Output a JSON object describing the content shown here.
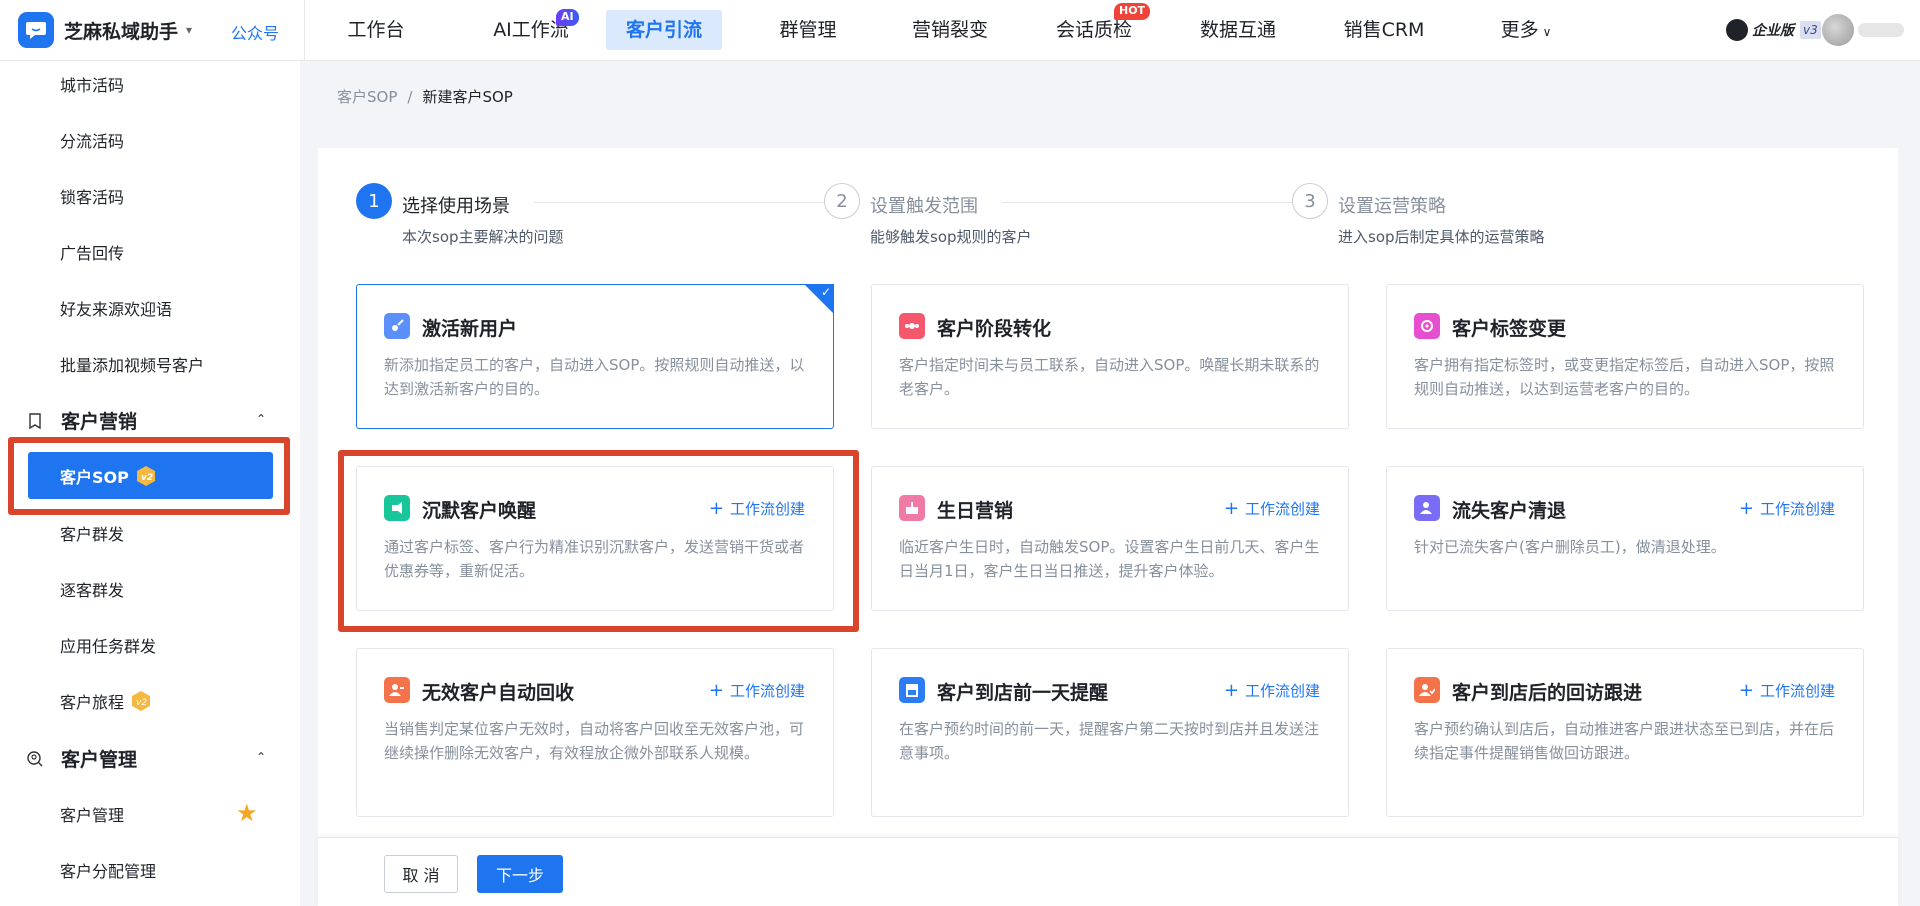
{
  "brand": {
    "name": "芝麻私域助手",
    "sub": "公众号"
  },
  "nav": [
    {
      "label": "工作台"
    },
    {
      "label": "AI工作流",
      "badge": "AI"
    },
    {
      "label": "客户引流",
      "active": true
    },
    {
      "label": "群管理"
    },
    {
      "label": "营销裂变"
    },
    {
      "label": "会话质检",
      "badge": "HOT"
    },
    {
      "label": "数据互通"
    },
    {
      "label": "销售CRM"
    },
    {
      "label": "更多"
    }
  ],
  "account": {
    "edition": "企业版",
    "version": "v3"
  },
  "sidebar": {
    "items_top": [
      "城市活码",
      "分流活码",
      "锁客活码",
      "广告回传",
      "好友来源欢迎语",
      "批量添加视频号客户"
    ],
    "group_marketing": "客户营销",
    "active_item": "客户SOP",
    "items_marketing": [
      "客户群发",
      "逐客群发",
      "应用任务群发",
      "客户旅程"
    ],
    "group_manage": "客户管理",
    "items_manage": [
      "客户管理",
      "客户分配管理"
    ]
  },
  "breadcrumb": {
    "parent": "客户SOP",
    "separator": "/",
    "current": "新建客户SOP"
  },
  "steps": [
    {
      "num": "1",
      "title": "选择使用场景",
      "desc": "本次sop主要解决的问题"
    },
    {
      "num": "2",
      "title": "设置触发范围",
      "desc": "能够触发sop规则的客户"
    },
    {
      "num": "3",
      "title": "设置运营策略",
      "desc": "进入sop后制定具体的运营策略"
    }
  ],
  "workflow_label": "工作流创建",
  "cards": [
    {
      "title": "激活新用户",
      "desc": "新添加指定员工的客户，自动进入SOP。按照规则自动推送，以达到激活新客户的目的。",
      "icon_color": "#5b8ff9"
    },
    {
      "title": "客户阶段转化",
      "desc": "客户指定时间未与员工联系，自动进入SOP。唤醒长期未联系的老客户。",
      "icon_color": "#f5576c"
    },
    {
      "title": "客户标签变更",
      "desc": "客户拥有指定标签时，或变更指定标签后，自动进入SOP，按照规则自动推送，以达到运营老客户的目的。",
      "icon_color": "#e54fd0"
    },
    {
      "title": "沉默客户唤醒",
      "desc": "通过客户标签、客户行为精准识别沉默客户，发送营销干货或者优惠券等，重新促活。",
      "icon_color": "#19c59b"
    },
    {
      "title": "生日营销",
      "desc": "临近客户生日时，自动触发SOP。设置客户生日前几天、客户生日当月1日，客户生日当日推送，提升客户体验。",
      "icon_color": "#f07aa6"
    },
    {
      "title": "流失客户清退",
      "desc": "针对已流失客户(客户删除员工)，做清退处理。",
      "icon_color": "#7b6cf6"
    },
    {
      "title": "无效客户自动回收",
      "desc": "当销售判定某位客户无效时，自动将客户回收至无效客户池，可继续操作删除无效客户，有效程放企微外部联系人规模。",
      "icon_color": "#f5734a"
    },
    {
      "title": "客户到店前一天提醒",
      "desc": "在客户预约时间的前一天，提醒客户第二天按时到店并且发送注意事项。",
      "icon_color": "#2b7df6"
    },
    {
      "title": "客户到店后的回访跟进",
      "desc": "客户预约确认到店后，自动推进客户跟进状态至已到店，并在后续指定事件提醒销售做回访跟进。",
      "icon_color": "#f5734a"
    }
  ],
  "footer": {
    "cancel": "取 消",
    "next": "下一步"
  }
}
